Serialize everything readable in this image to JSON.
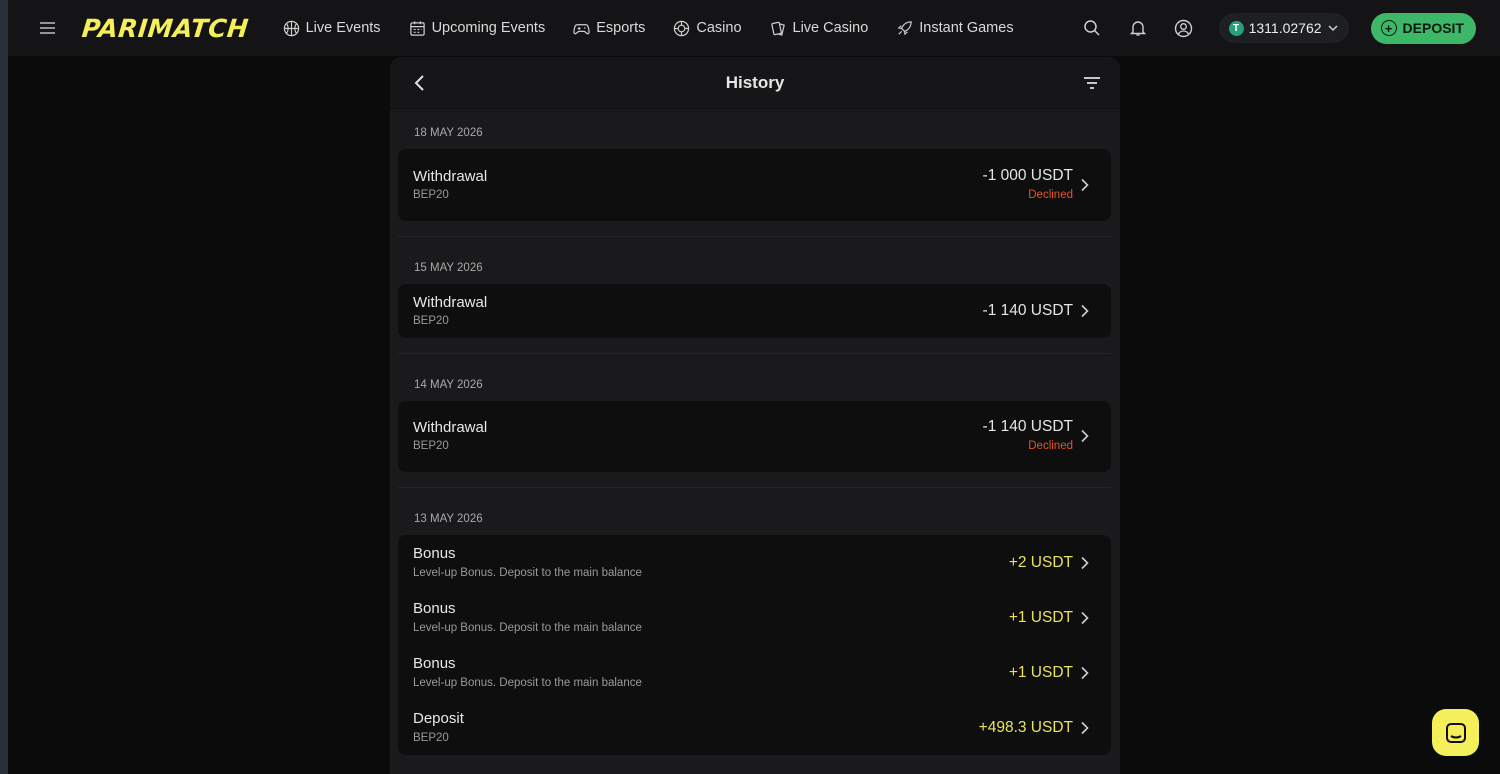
{
  "brand": {
    "logo_text": "PARIMATCH",
    "accent": "#f5ef5a"
  },
  "nav": [
    {
      "label": "Live Events",
      "icon": "basketball-icon"
    },
    {
      "label": "Upcoming Events",
      "icon": "calendar-icon"
    },
    {
      "label": "Esports",
      "icon": "gamepad-icon"
    },
    {
      "label": "Casino",
      "icon": "casino-chip-icon"
    },
    {
      "label": "Live Casino",
      "icon": "cards-icon"
    },
    {
      "label": "Instant Games",
      "icon": "rocket-icon"
    }
  ],
  "header": {
    "balance": "1311.02762",
    "currency_symbol": "T",
    "deposit_label": "DEPOSIT",
    "deposit_color": "#3cb868"
  },
  "history": {
    "title": "History",
    "groups": [
      {
        "date": "18 MAY 2026",
        "items": [
          {
            "title": "Withdrawal",
            "subtitle": "BEP20",
            "amount": "-1 000 USDT",
            "status": "Declined"
          }
        ]
      },
      {
        "date": "15 MAY 2026",
        "items": [
          {
            "title": "Withdrawal",
            "subtitle": "BEP20",
            "amount": "-1 140 USDT",
            "status": ""
          }
        ]
      },
      {
        "date": "14 MAY 2026",
        "items": [
          {
            "title": "Withdrawal",
            "subtitle": "BEP20",
            "amount": "-1 140 USDT",
            "status": "Declined"
          }
        ]
      },
      {
        "date": "13 MAY 2026",
        "items": [
          {
            "title": "Bonus",
            "subtitle": "Level-up Bonus. Deposit to the main balance",
            "amount": "+2 USDT",
            "status": ""
          },
          {
            "title": "Bonus",
            "subtitle": "Level-up Bonus. Deposit to the main balance",
            "amount": "+1 USDT",
            "status": ""
          },
          {
            "title": "Bonus",
            "subtitle": "Level-up Bonus. Deposit to the main balance",
            "amount": "+1 USDT",
            "status": ""
          },
          {
            "title": "Deposit",
            "subtitle": "BEP20",
            "amount": "+498.3 USDT",
            "status": ""
          }
        ]
      }
    ],
    "colors": {
      "positive": "#e9e45c",
      "declined": "#e5532e"
    }
  }
}
